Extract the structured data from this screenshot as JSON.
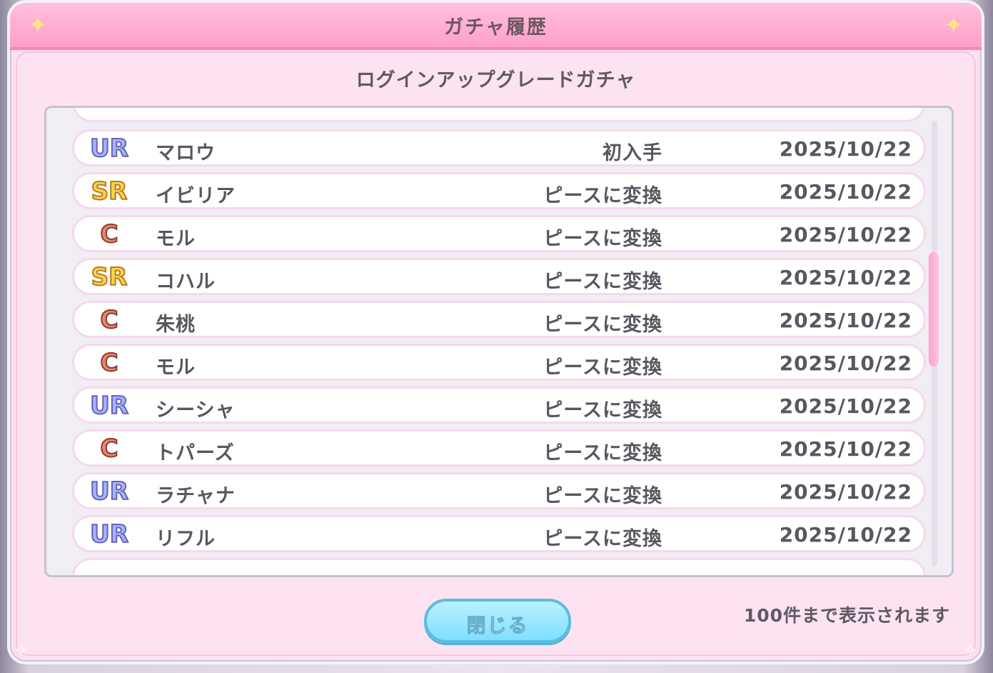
{
  "dialog": {
    "title": "ガチャ履歴",
    "subtitle": "ログインアップグレードガチャ",
    "close_label": "閉じる",
    "note": "100件まで表示されます"
  },
  "history": [
    {
      "rarity": "UR",
      "name": "マロウ",
      "status": "初入手",
      "date": "2025/10/22"
    },
    {
      "rarity": "SR",
      "name": "イビリア",
      "status": "ピースに変換",
      "date": "2025/10/22"
    },
    {
      "rarity": "C",
      "name": "モル",
      "status": "ピースに変換",
      "date": "2025/10/22"
    },
    {
      "rarity": "SR",
      "name": "コハル",
      "status": "ピースに変換",
      "date": "2025/10/22"
    },
    {
      "rarity": "C",
      "name": "朱桃",
      "status": "ピースに変換",
      "date": "2025/10/22"
    },
    {
      "rarity": "C",
      "name": "モル",
      "status": "ピースに変換",
      "date": "2025/10/22"
    },
    {
      "rarity": "UR",
      "name": "シーシャ",
      "status": "ピースに変換",
      "date": "2025/10/22"
    },
    {
      "rarity": "C",
      "name": "トパーズ",
      "status": "ピースに変換",
      "date": "2025/10/22"
    },
    {
      "rarity": "UR",
      "name": "ラチャナ",
      "status": "ピースに変換",
      "date": "2025/10/22"
    },
    {
      "rarity": "UR",
      "name": "リフル",
      "status": "ピースに変換",
      "date": "2025/10/22"
    }
  ],
  "scroll": {
    "position": 0.35,
    "visible_fraction": 0.26
  },
  "icons": {
    "header_sparkle": "sparkle-icon",
    "corner": "diamond-sparkle-icon"
  },
  "colors": {
    "header": "#ff9fc9",
    "panel": "#fde3f1",
    "button": "#7fdfff",
    "UR": "#9fb7ff",
    "SR": "#ffd34a",
    "C": "#e6866f"
  }
}
